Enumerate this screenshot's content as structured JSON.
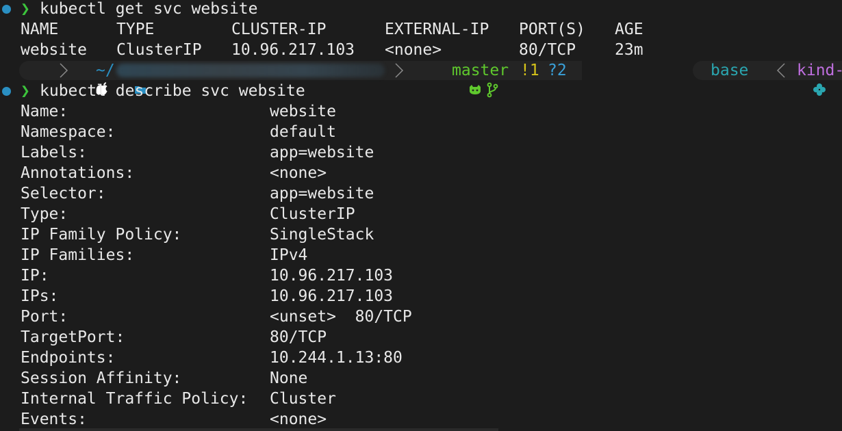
{
  "colors": {
    "background": "#1c1c1c",
    "text": "#e8e8e8",
    "prompt_dot": "#2a8fc2",
    "prompt_chevron": "#3cc43c",
    "path_blue": "#2a8fc2",
    "git_green": "#5fc82d",
    "git_modified": "#d6c31a",
    "git_untracked": "#3aa0d8",
    "env_teal": "#2aa6b0",
    "context_purple": "#c06fe0"
  },
  "cmd1": {
    "chevron": "❯",
    "command": "kubectl get svc website",
    "headers": [
      "NAME",
      "TYPE",
      "CLUSTER-IP",
      "EXTERNAL-IP",
      "PORT(S)",
      "AGE"
    ],
    "row": [
      "website",
      "ClusterIP",
      "10.96.217.103",
      "<none>",
      "80/TCP",
      "23m"
    ]
  },
  "prompt_bar": {
    "apple_icon": "apple-icon",
    "folder_icon": "folder-icon",
    "path": "~/",
    "git_icon": "github-cat-icon",
    "branch_icon": "git-branch-icon",
    "branch": "master",
    "modified": "!1",
    "untracked": "?2",
    "env": "base",
    "env_icon": "conda-clover-icon",
    "context": "kind-"
  },
  "cmd2": {
    "chevron": "❯",
    "command": "kubectl describe svc website",
    "fields": [
      {
        "key": "Name:",
        "value": "website"
      },
      {
        "key": "Namespace:",
        "value": "default"
      },
      {
        "key": "Labels:",
        "value": "app=website"
      },
      {
        "key": "Annotations:",
        "value": "<none>"
      },
      {
        "key": "Selector:",
        "value": "app=website"
      },
      {
        "key": "Type:",
        "value": "ClusterIP"
      },
      {
        "key": "IP Family Policy:",
        "value": "SingleStack"
      },
      {
        "key": "IP Families:",
        "value": "IPv4"
      },
      {
        "key": "IP:",
        "value": "10.96.217.103"
      },
      {
        "key": "IPs:",
        "value": "10.96.217.103"
      },
      {
        "key": "Port:",
        "value": "<unset>  80/TCP"
      },
      {
        "key": "TargetPort:",
        "value": "80/TCP"
      },
      {
        "key": "Endpoints:",
        "value": "10.244.1.13:80"
      },
      {
        "key": "Session Affinity:",
        "value": "None"
      },
      {
        "key": "Internal Traffic Policy:",
        "value": "Cluster"
      },
      {
        "key": "Events:",
        "value": "<none>"
      }
    ]
  }
}
